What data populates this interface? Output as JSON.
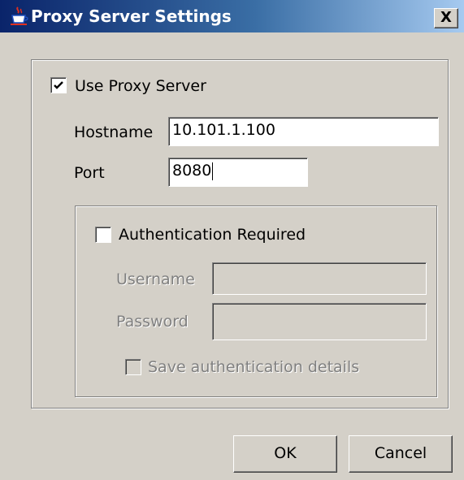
{
  "window": {
    "title": "Proxy Server Settings",
    "close_label": "X",
    "icon": "java-coffee-cup-icon"
  },
  "proxy": {
    "use_proxy_label": "Use Proxy Server",
    "use_proxy_checked": true,
    "hostname_label": "Hostname",
    "hostname_value": "10.101.1.100",
    "port_label": "Port",
    "port_value": "8080"
  },
  "auth": {
    "required_label": "Authentication Required",
    "required_checked": false,
    "username_label": "Username",
    "username_value": "",
    "password_label": "Password",
    "password_value": "",
    "save_details_label": "Save authentication details",
    "save_details_checked": false
  },
  "buttons": {
    "ok_label": "OK",
    "cancel_label": "Cancel"
  },
  "colors": {
    "window_bg": "#d4d0c8",
    "titlebar_start": "#0a246a",
    "titlebar_end": "#a6caf0",
    "disabled_text": "#808080"
  }
}
